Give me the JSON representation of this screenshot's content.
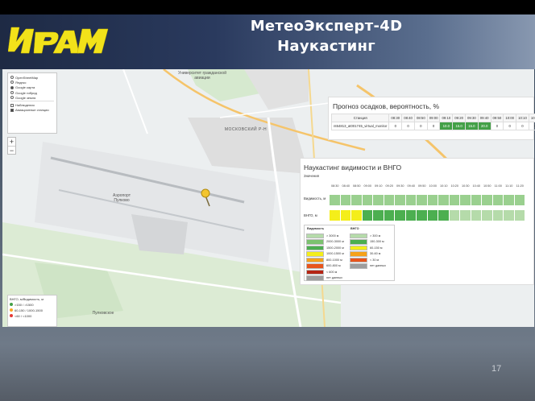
{
  "header": {
    "logo_text": "ИРАМ",
    "title_line1": "МетеоЭксперт-4D",
    "title_line2": "Наукастинг"
  },
  "map": {
    "layers": [
      "OpenStreetMap",
      "Яндекс",
      "Google карта",
      "Google гибрид",
      "Google земля",
      "Наблюдения",
      "Авиационные станции"
    ],
    "layers_selected": 2,
    "zoom_in": "+",
    "zoom_out": "−",
    "labels": {
      "district": "МОСКОВСКИЙ Р-Н",
      "airport": "Аэропорт Пулково",
      "university": "Университет гражданской авиации",
      "town": "Пулковское"
    },
    "vis_legend": {
      "title": "ВНГО, м/Видимость, м",
      "items": [
        {
          "label": ">150 / >1500",
          "color": "#43a047"
        },
        {
          "label": "60-150 / 1000-1500",
          "color": "#f9a825"
        },
        {
          "label": "<60 / <1000",
          "color": "#e53935"
        }
      ]
    }
  },
  "precip": {
    "title": "Прогноз осадков, вероятность, %",
    "header": [
      "Станция",
      "08:30",
      "08:40",
      "08:50",
      "09:00",
      "09:10",
      "09:20",
      "09:30",
      "09:40",
      "09:50",
      "10:00",
      "10:10",
      "10:20",
      "10:30"
    ],
    "row": [
      "nt64813_at001745_virtual_monitor",
      "0",
      "0",
      "0",
      "0",
      "10.0",
      "15.0",
      "15.0",
      "20.0",
      "0",
      "0",
      "0",
      "0",
      "0"
    ]
  },
  "nowcast": {
    "title": "Наукастинг видимости и ВНГО",
    "subtitle": "Значения",
    "times": [
      "08:30",
      "08:40",
      "08:50",
      "09:00",
      "09:10",
      "09:20",
      "09:30",
      "09:40",
      "09:50",
      "10:00",
      "10:10",
      "10:20",
      "10:30",
      "10:40",
      "10:50",
      "11:00",
      "11:10",
      "11:20"
    ],
    "rows": [
      {
        "label": "Видимость, м",
        "colors": [
          "#9ad08f",
          "#9ad08f",
          "#9ad08f",
          "#9ad08f",
          "#9ad08f",
          "#9ad08f",
          "#9ad08f",
          "#9ad08f",
          "#9ad08f",
          "#9ad08f",
          "#9ad08f",
          "#9ad08f",
          "#9ad08f",
          "#9ad08f",
          "#9ad08f",
          "#9ad08f",
          "#9ad08f",
          "#9ad08f"
        ]
      },
      {
        "label": "ВНГО, м",
        "colors": [
          "#f4ee1a",
          "#f4ee1a",
          "#f4ee1a",
          "#4caf50",
          "#4caf50",
          "#4caf50",
          "#4caf50",
          "#4caf50",
          "#4caf50",
          "#4caf50",
          "#4caf50",
          "#b5dbaa",
          "#b5dbaa",
          "#b5dbaa",
          "#b5dbaa",
          "#b5dbaa",
          "#b5dbaa",
          "#b5dbaa"
        ]
      }
    ],
    "legend": {
      "vis_title": "Видимость",
      "cb_title": "ВНГО",
      "vis": [
        {
          "label": "> 3000 м",
          "color": "#b5dbaa"
        },
        {
          "label": "2000-3000 м",
          "color": "#7cc26f"
        },
        {
          "label": "1500-2000 м",
          "color": "#4caf50"
        },
        {
          "label": "1000-1500 м",
          "color": "#f4ee1a"
        },
        {
          "label": "800-1000 м",
          "color": "#f6a21a"
        },
        {
          "label": "600-800 м",
          "color": "#e8551c"
        },
        {
          "label": "< 600 м",
          "color": "#b52414"
        },
        {
          "label": "нет данных",
          "color": "#9e9e9e"
        }
      ],
      "cb": [
        {
          "label": "> 300 м",
          "color": "#b5dbaa"
        },
        {
          "label": "150-300 м",
          "color": "#4caf50"
        },
        {
          "label": "60-150 м",
          "color": "#f4ee1a"
        },
        {
          "label": "30-60 м",
          "color": "#f6a21a"
        },
        {
          "label": "< 30 м",
          "color": "#e8551c"
        },
        {
          "label": "нет данных",
          "color": "#9e9e9e"
        }
      ]
    }
  },
  "page_number": "17"
}
